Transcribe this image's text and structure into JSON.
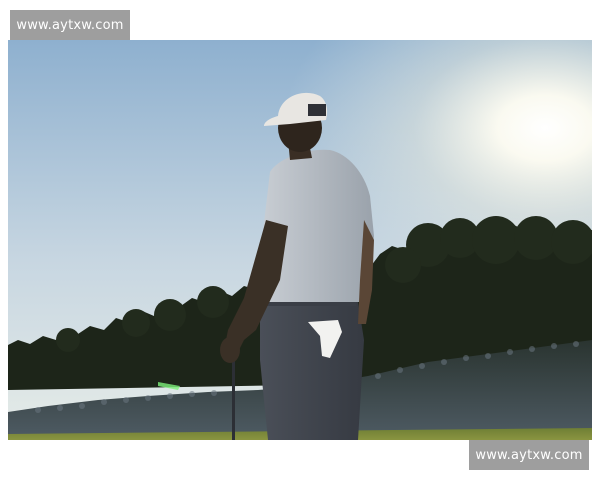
{
  "watermark": {
    "top_text": "www.aytxw.com",
    "bottom_text": "www.aytxw.com"
  },
  "photo": {
    "subject": "golfer-silhouette",
    "colors": {
      "sky_top": "#8fb3d4",
      "sky_bottom": "#e8eef2",
      "sun_glow": "#ffffff",
      "treeline": "#1c2418",
      "crowd": "#3c4a52",
      "grass": "#7a8a3a"
    }
  }
}
